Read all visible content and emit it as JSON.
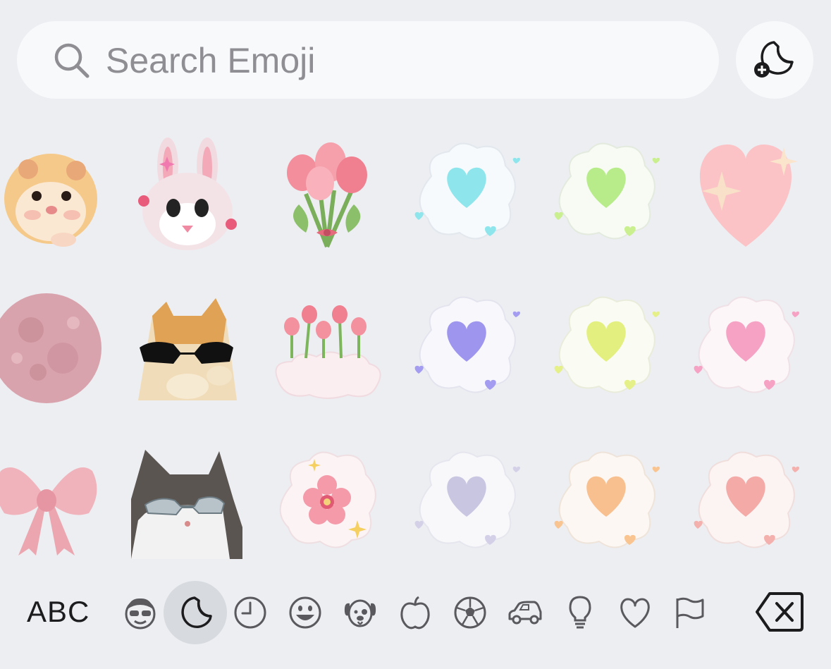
{
  "search": {
    "placeholder": "Search Emoji"
  },
  "stickers": {
    "rows": [
      [
        "hamster",
        "bunny-memoji",
        "pink-tulip-bouquet",
        "blue-heart-cloud",
        "green-heart-cloud",
        "peach-sparkle-heart"
      ],
      [
        "pink-moon",
        "cat-with-sunglasses",
        "tulips-on-cloud",
        "purple-heart-cloud",
        "yellow-heart-cloud",
        "pink-heart-cloud"
      ],
      [
        "pink-bow",
        "cat-with-silver-sunglasses",
        "flower-cloud",
        "lavender-heart-cloud",
        "orange-heart-cloud",
        "coral-heart-cloud"
      ]
    ]
  },
  "keyboard": {
    "abc_label": "ABC",
    "categories": [
      "memoji-icon",
      "sticker-icon",
      "recent-clock-icon",
      "smiley-icon",
      "animal-icon",
      "food-apple-icon",
      "activity-ball-icon",
      "travel-car-icon",
      "objects-bulb-icon",
      "symbols-heart-icon",
      "flags-icon"
    ],
    "active_category": "sticker-icon"
  },
  "colors": {
    "background": "#eceef2",
    "search_bg": "#f8f9fb",
    "active_tab": "#d7dade"
  }
}
